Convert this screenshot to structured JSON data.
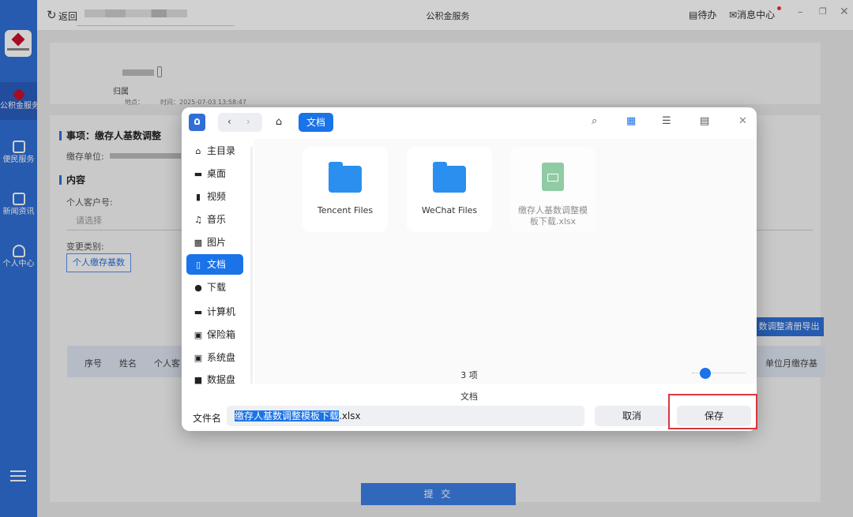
{
  "topbar": {
    "back_label": "返回",
    "title": "公积金服务",
    "todo_label": "待办",
    "message_label": "消息中心",
    "refresh_icon": "refresh-icon",
    "minimize_glyph": "–",
    "maximize_glyph": "❐",
    "close_glyph": "✕"
  },
  "leftnav": {
    "items": [
      {
        "label": "公积金服务",
        "icon": "provident-fund-icon"
      },
      {
        "label": "便民服务",
        "icon": "service-icon"
      },
      {
        "label": "新闻资讯",
        "icon": "news-icon"
      },
      {
        "label": "个人中心",
        "icon": "user-icon"
      }
    ],
    "accent": "#2f6fd6"
  },
  "main": {
    "card1": {
      "attribution": "归属",
      "location_label": "地点：",
      "time_label": "时间：2025-07-03 13:58:47"
    },
    "card2": {
      "matter_title": "事项：缴存人基数调整",
      "unit_label": "缴存单位:",
      "content_title": "内容",
      "customer_no_label": "个人客户号:",
      "customer_no_placeholder": "请选择",
      "change_type_label": "变更类别:",
      "change_type_value": "个人缴存基数",
      "export_label": "数调整清册导出",
      "table_headers": [
        "序号",
        "姓名",
        "个人客",
        "单位月缴存基"
      ],
      "submit_label": "提 交"
    }
  },
  "dialog": {
    "current_folder": "文档",
    "sidebar": [
      {
        "label": "主目录",
        "icon": "home-icon"
      },
      {
        "label": "桌面",
        "icon": "desktop-icon"
      },
      {
        "label": "视频",
        "icon": "video-icon"
      },
      {
        "label": "音乐",
        "icon": "music-icon"
      },
      {
        "label": "图片",
        "icon": "picture-icon"
      },
      {
        "label": "文档",
        "icon": "document-icon",
        "active": true
      },
      {
        "label": "下载",
        "icon": "download-icon"
      },
      {
        "label": "计算机",
        "icon": "computer-icon"
      },
      {
        "label": "保险箱",
        "icon": "safe-icon"
      },
      {
        "label": "系统盘",
        "icon": "system-disk-icon"
      },
      {
        "label": "数据盘",
        "icon": "data-disk-icon"
      }
    ],
    "files": [
      {
        "name": "Tencent Files",
        "type": "folder"
      },
      {
        "name": "WeChat Files",
        "type": "folder"
      },
      {
        "name": "缴存人基数调整模板下载.xlsx",
        "name_line1": "缴存人基数调整模",
        "name_line2": "板下载.xlsx",
        "type": "xlsx",
        "dimmed": true
      }
    ],
    "item_count": "3 项",
    "path_label": "文档",
    "filename_label": "文件名",
    "filename_selected": "缴存人基数调整模板下载",
    "filename_ext": ".xlsx",
    "cancel_label": "取消",
    "save_label": "保存",
    "accent": "#1a73e8",
    "highlight_color": "#d9363e"
  }
}
